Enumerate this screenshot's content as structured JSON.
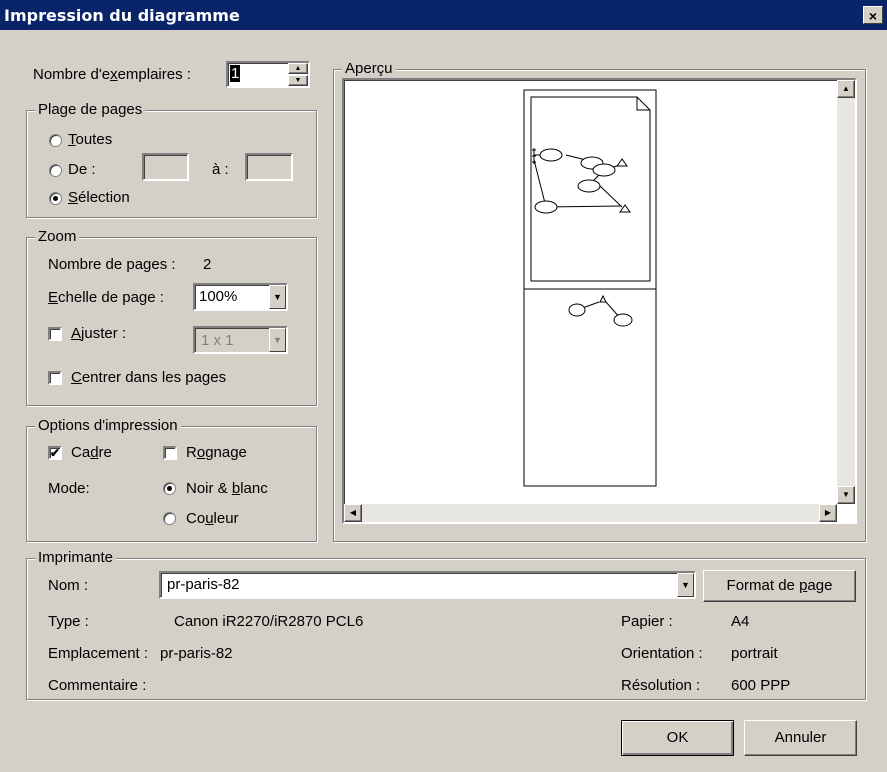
{
  "window": {
    "title": "Impression du diagramme",
    "close_glyph": "×"
  },
  "copies": {
    "label_pre": "Nombre d'e",
    "label_key": "x",
    "label_post": "emplaires :",
    "value": "1"
  },
  "page_range": {
    "legend": "Plage de pages",
    "all_key": "T",
    "all_rest": "outes",
    "from_label": "De :",
    "to_label": "à :",
    "from_value": "",
    "to_value": "",
    "selection_key": "S",
    "selection_rest": "élection",
    "selected": "selection"
  },
  "zoom": {
    "legend": "Zoom",
    "pages_label": "Nombre de pages :",
    "pages_value": "2",
    "scale_key": "E",
    "scale_rest": "chelle de page :",
    "scale_value": "100%",
    "fit_key": "A",
    "fit_rest": "juster :",
    "fit_value": "1 x 1",
    "fit_checked": false,
    "center_key": "C",
    "center_rest": "entrer dans les pages",
    "center_checked": false
  },
  "print_options": {
    "legend": "Options d'impression",
    "frame_pre": "Ca",
    "frame_key": "d",
    "frame_post": "re",
    "frame_checked": true,
    "crop_pre": "R",
    "crop_key": "o",
    "crop_post": "gnage",
    "crop_checked": false,
    "mode_label": "Mode:",
    "bw_pre": "Noir & ",
    "bw_key": "b",
    "bw_post": "lanc",
    "color_pre": "Co",
    "color_key": "u",
    "color_post": "leur",
    "mode_selected": "bw"
  },
  "preview": {
    "legend": "Aperçu"
  },
  "printer": {
    "legend": "Imprimante",
    "name_label": "Nom :",
    "name_value": "pr-paris-82",
    "page_setup_pre": "Format de ",
    "page_setup_key": "p",
    "page_setup_post": "age",
    "type_label": "Type :",
    "type_value": "Canon iR2270/iR2870 PCL6",
    "location_label": "Emplacement :",
    "location_value": "pr-paris-82",
    "comment_label": "Commentaire :",
    "comment_value": "",
    "paper_label": "Papier :",
    "paper_value": "A4",
    "orientation_label": "Orientation :",
    "orientation_value": "portrait",
    "resolution_label": "Résolution :",
    "resolution_value": "600 PPP"
  },
  "buttons": {
    "ok": "OK",
    "cancel": "Annuler"
  },
  "icons": {
    "spin_up": "triangle-up-icon",
    "spin_down": "triangle-down-icon",
    "dropdown": "dropdown-arrow-icon"
  }
}
